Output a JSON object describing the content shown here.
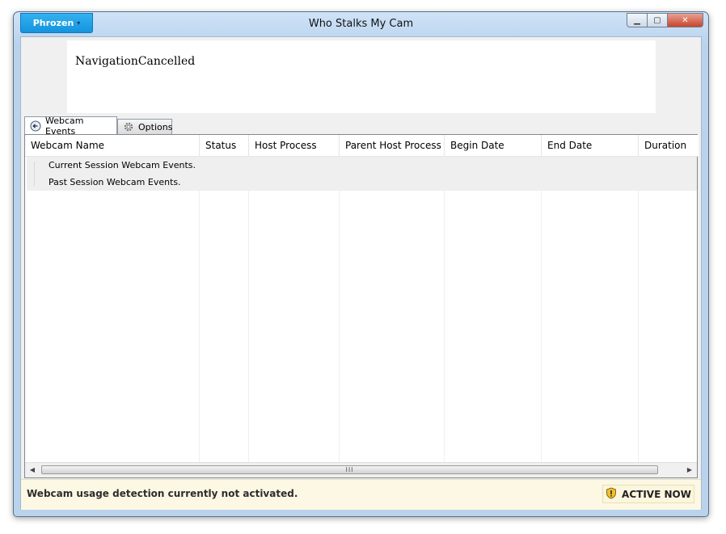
{
  "titlebar": {
    "brand_label": "Phrozen",
    "brand_caret": "▾",
    "title": "Who Stalks My Cam",
    "min_glyph": "▁",
    "max_glyph": "▢",
    "close_glyph": "✕"
  },
  "browser_panel": {
    "message": "NavigationCancelled"
  },
  "tabs": [
    {
      "label": "Webcam Events",
      "icon": "back-arrow-icon",
      "active": true
    },
    {
      "label": "Options",
      "icon": "gear-icon",
      "active": false
    }
  ],
  "grid": {
    "columns": [
      "Webcam Name",
      "Status",
      "Host Process",
      "Parent Host Process",
      "Begin Date",
      "End Date",
      "Duration"
    ],
    "groups": [
      "Current Session Webcam Events.",
      "Past Session Webcam Events."
    ],
    "scroll_grip": "III",
    "scroll_left": "◀",
    "scroll_right": "▶"
  },
  "status": {
    "message": "Webcam usage detection currently not activated.",
    "button_label": "ACTIVE NOW",
    "button_icon": "shield-warning-icon"
  },
  "colors": {
    "accent": "#1a9be3",
    "status_bg": "#fdf8e3",
    "close": "#c9442b"
  }
}
